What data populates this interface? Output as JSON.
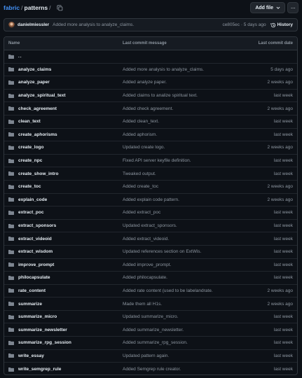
{
  "breadcrumb": {
    "repo": "fabric",
    "separator": "/",
    "current": "patterns",
    "trailing_separator": "/"
  },
  "toolbar": {
    "add_file_label": "Add file",
    "more_label": "···"
  },
  "latest_commit": {
    "author": "danielmiessler",
    "message": "Added more analysis to analyze_claims.",
    "hash_time": "ce805ec · 5 days ago",
    "history_label": "History"
  },
  "table": {
    "headers": {
      "name": "Name",
      "message": "Last commit message",
      "date": "Last commit date"
    },
    "parent": "..",
    "rows": [
      {
        "name": "analyze_claims",
        "message": "Added more analysis to analyze_claims.",
        "date": "5 days ago"
      },
      {
        "name": "analyze_paper",
        "message": "Added analyze paper.",
        "date": "2 weeks ago"
      },
      {
        "name": "analyze_spiritual_text",
        "message": "Added claims to analize spiritual text.",
        "date": "last week"
      },
      {
        "name": "check_agreement",
        "message": "Added check agreement.",
        "date": "2 weeks ago"
      },
      {
        "name": "clean_text",
        "message": "Added clean_text.",
        "date": "last week"
      },
      {
        "name": "create_aphorisms",
        "message": "Added aphorism.",
        "date": "last week"
      },
      {
        "name": "create_logo",
        "message": "Updated create logo.",
        "date": "2 weeks ago"
      },
      {
        "name": "create_npc",
        "message": "Fixed API server keyfile definition.",
        "date": "last week"
      },
      {
        "name": "create_show_intro",
        "message": "Tweaked output.",
        "date": "last week"
      },
      {
        "name": "create_toc",
        "message": "Added create_toc",
        "date": "2 weeks ago"
      },
      {
        "name": "explain_code",
        "message": "Added explain code pattern.",
        "date": "2 weeks ago"
      },
      {
        "name": "extract_poc",
        "message": "Added extract_poc",
        "date": "last week"
      },
      {
        "name": "extract_sponsors",
        "message": "Updated extract_sponsors.",
        "date": "last week"
      },
      {
        "name": "extract_videoid",
        "message": "Added extract_videoid.",
        "date": "last week"
      },
      {
        "name": "extract_wisdom",
        "message": "Updated references section on ExtWis.",
        "date": "last week"
      },
      {
        "name": "improve_prompt",
        "message": "Added improve_prompt.",
        "date": "last week"
      },
      {
        "name": "philocapsulate",
        "message": "Added philocapsulate.",
        "date": "last week"
      },
      {
        "name": "rate_content",
        "message": "Added rate content (used to be labelandrate.",
        "date": "2 weeks ago"
      },
      {
        "name": "summarize",
        "message": "Made them all H1s.",
        "date": "2 weeks ago"
      },
      {
        "name": "summarize_micro",
        "message": "Updated summarize_micro.",
        "date": "last week"
      },
      {
        "name": "summarize_newsletter",
        "message": "Added summarize_newsletter.",
        "date": "last week"
      },
      {
        "name": "summarize_rpg_session",
        "message": "Added summarize_rpg_session.",
        "date": "last week"
      },
      {
        "name": "write_essay",
        "message": "Updated pattern again.",
        "date": "last week"
      },
      {
        "name": "write_semgrep_rule",
        "message": "Added Semgrep rule creator.",
        "date": "last week"
      }
    ]
  },
  "icons": {
    "folder": "folder-icon",
    "copy": "copy-icon",
    "history": "history-icon",
    "caret": "chevron-down-icon"
  },
  "colors": {
    "background": "#0d1117",
    "link": "#4493f8",
    "folder": "#7d8590",
    "muted": "#8d96a0",
    "border": "#30363d"
  }
}
